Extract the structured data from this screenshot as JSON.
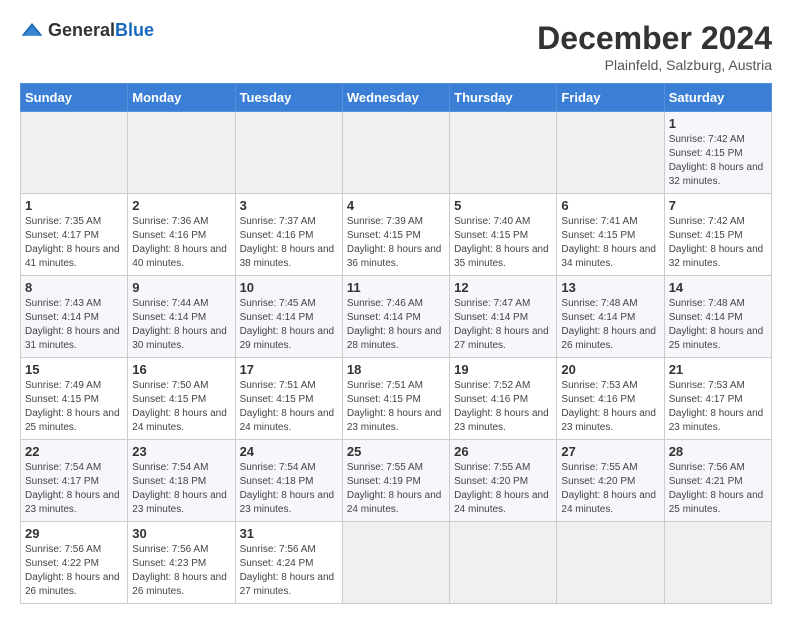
{
  "header": {
    "logo_general": "General",
    "logo_blue": "Blue",
    "title": "December 2024",
    "subtitle": "Plainfeld, Salzburg, Austria"
  },
  "calendar": {
    "days_of_week": [
      "Sunday",
      "Monday",
      "Tuesday",
      "Wednesday",
      "Thursday",
      "Friday",
      "Saturday"
    ],
    "weeks": [
      [
        {
          "day": "",
          "empty": true
        },
        {
          "day": "",
          "empty": true
        },
        {
          "day": "",
          "empty": true
        },
        {
          "day": "",
          "empty": true
        },
        {
          "day": "",
          "empty": true
        },
        {
          "day": "",
          "empty": true
        },
        {
          "day": "1",
          "sunrise": "Sunrise: 7:42 AM",
          "sunset": "Sunset: 4:15 PM",
          "daylight": "Daylight: 8 hours and 32 minutes."
        }
      ],
      [
        {
          "day": "1",
          "sunrise": "Sunrise: 7:35 AM",
          "sunset": "Sunset: 4:17 PM",
          "daylight": "Daylight: 8 hours and 41 minutes."
        },
        {
          "day": "2",
          "sunrise": "Sunrise: 7:36 AM",
          "sunset": "Sunset: 4:16 PM",
          "daylight": "Daylight: 8 hours and 40 minutes."
        },
        {
          "day": "3",
          "sunrise": "Sunrise: 7:37 AM",
          "sunset": "Sunset: 4:16 PM",
          "daylight": "Daylight: 8 hours and 38 minutes."
        },
        {
          "day": "4",
          "sunrise": "Sunrise: 7:39 AM",
          "sunset": "Sunset: 4:15 PM",
          "daylight": "Daylight: 8 hours and 36 minutes."
        },
        {
          "day": "5",
          "sunrise": "Sunrise: 7:40 AM",
          "sunset": "Sunset: 4:15 PM",
          "daylight": "Daylight: 8 hours and 35 minutes."
        },
        {
          "day": "6",
          "sunrise": "Sunrise: 7:41 AM",
          "sunset": "Sunset: 4:15 PM",
          "daylight": "Daylight: 8 hours and 34 minutes."
        },
        {
          "day": "7",
          "sunrise": "Sunrise: 7:42 AM",
          "sunset": "Sunset: 4:15 PM",
          "daylight": "Daylight: 8 hours and 32 minutes."
        }
      ],
      [
        {
          "day": "8",
          "sunrise": "Sunrise: 7:43 AM",
          "sunset": "Sunset: 4:14 PM",
          "daylight": "Daylight: 8 hours and 31 minutes."
        },
        {
          "day": "9",
          "sunrise": "Sunrise: 7:44 AM",
          "sunset": "Sunset: 4:14 PM",
          "daylight": "Daylight: 8 hours and 30 minutes."
        },
        {
          "day": "10",
          "sunrise": "Sunrise: 7:45 AM",
          "sunset": "Sunset: 4:14 PM",
          "daylight": "Daylight: 8 hours and 29 minutes."
        },
        {
          "day": "11",
          "sunrise": "Sunrise: 7:46 AM",
          "sunset": "Sunset: 4:14 PM",
          "daylight": "Daylight: 8 hours and 28 minutes."
        },
        {
          "day": "12",
          "sunrise": "Sunrise: 7:47 AM",
          "sunset": "Sunset: 4:14 PM",
          "daylight": "Daylight: 8 hours and 27 minutes."
        },
        {
          "day": "13",
          "sunrise": "Sunrise: 7:48 AM",
          "sunset": "Sunset: 4:14 PM",
          "daylight": "Daylight: 8 hours and 26 minutes."
        },
        {
          "day": "14",
          "sunrise": "Sunrise: 7:48 AM",
          "sunset": "Sunset: 4:14 PM",
          "daylight": "Daylight: 8 hours and 25 minutes."
        }
      ],
      [
        {
          "day": "15",
          "sunrise": "Sunrise: 7:49 AM",
          "sunset": "Sunset: 4:15 PM",
          "daylight": "Daylight: 8 hours and 25 minutes."
        },
        {
          "day": "16",
          "sunrise": "Sunrise: 7:50 AM",
          "sunset": "Sunset: 4:15 PM",
          "daylight": "Daylight: 8 hours and 24 minutes."
        },
        {
          "day": "17",
          "sunrise": "Sunrise: 7:51 AM",
          "sunset": "Sunset: 4:15 PM",
          "daylight": "Daylight: 8 hours and 24 minutes."
        },
        {
          "day": "18",
          "sunrise": "Sunrise: 7:51 AM",
          "sunset": "Sunset: 4:15 PM",
          "daylight": "Daylight: 8 hours and 23 minutes."
        },
        {
          "day": "19",
          "sunrise": "Sunrise: 7:52 AM",
          "sunset": "Sunset: 4:16 PM",
          "daylight": "Daylight: 8 hours and 23 minutes."
        },
        {
          "day": "20",
          "sunrise": "Sunrise: 7:53 AM",
          "sunset": "Sunset: 4:16 PM",
          "daylight": "Daylight: 8 hours and 23 minutes."
        },
        {
          "day": "21",
          "sunrise": "Sunrise: 7:53 AM",
          "sunset": "Sunset: 4:17 PM",
          "daylight": "Daylight: 8 hours and 23 minutes."
        }
      ],
      [
        {
          "day": "22",
          "sunrise": "Sunrise: 7:54 AM",
          "sunset": "Sunset: 4:17 PM",
          "daylight": "Daylight: 8 hours and 23 minutes."
        },
        {
          "day": "23",
          "sunrise": "Sunrise: 7:54 AM",
          "sunset": "Sunset: 4:18 PM",
          "daylight": "Daylight: 8 hours and 23 minutes."
        },
        {
          "day": "24",
          "sunrise": "Sunrise: 7:54 AM",
          "sunset": "Sunset: 4:18 PM",
          "daylight": "Daylight: 8 hours and 23 minutes."
        },
        {
          "day": "25",
          "sunrise": "Sunrise: 7:55 AM",
          "sunset": "Sunset: 4:19 PM",
          "daylight": "Daylight: 8 hours and 24 minutes."
        },
        {
          "day": "26",
          "sunrise": "Sunrise: 7:55 AM",
          "sunset": "Sunset: 4:20 PM",
          "daylight": "Daylight: 8 hours and 24 minutes."
        },
        {
          "day": "27",
          "sunrise": "Sunrise: 7:55 AM",
          "sunset": "Sunset: 4:20 PM",
          "daylight": "Daylight: 8 hours and 24 minutes."
        },
        {
          "day": "28",
          "sunrise": "Sunrise: 7:56 AM",
          "sunset": "Sunset: 4:21 PM",
          "daylight": "Daylight: 8 hours and 25 minutes."
        }
      ],
      [
        {
          "day": "29",
          "sunrise": "Sunrise: 7:56 AM",
          "sunset": "Sunset: 4:22 PM",
          "daylight": "Daylight: 8 hours and 26 minutes."
        },
        {
          "day": "30",
          "sunrise": "Sunrise: 7:56 AM",
          "sunset": "Sunset: 4:23 PM",
          "daylight": "Daylight: 8 hours and 26 minutes."
        },
        {
          "day": "31",
          "sunrise": "Sunrise: 7:56 AM",
          "sunset": "Sunset: 4:24 PM",
          "daylight": "Daylight: 8 hours and 27 minutes."
        },
        {
          "day": "",
          "empty": true
        },
        {
          "day": "",
          "empty": true
        },
        {
          "day": "",
          "empty": true
        },
        {
          "day": "",
          "empty": true
        }
      ]
    ]
  }
}
